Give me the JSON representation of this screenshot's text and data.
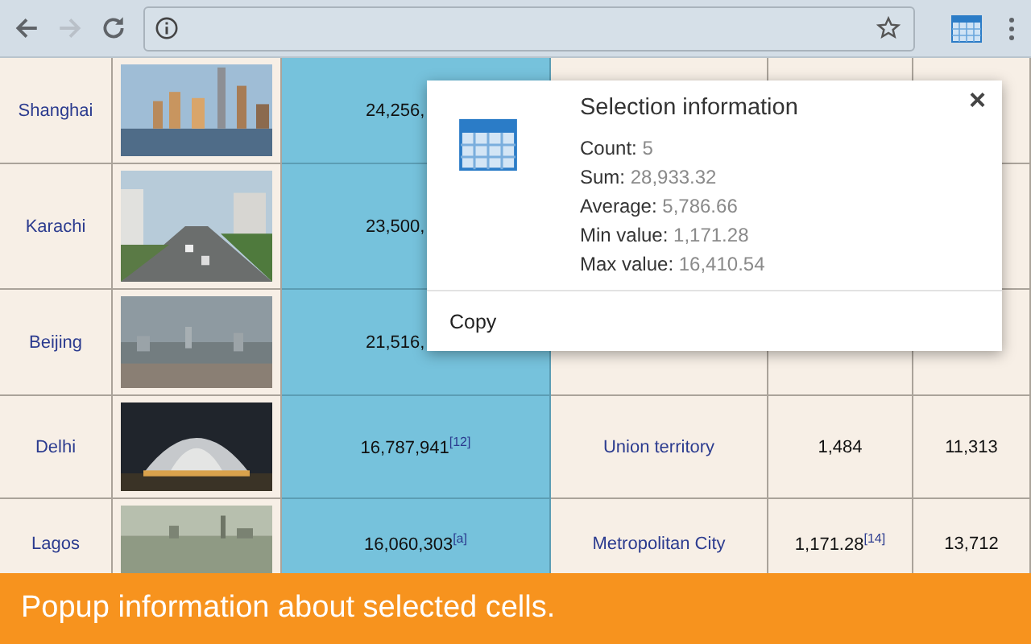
{
  "toolbar": {
    "forward_disabled": true
  },
  "table": {
    "rows": [
      {
        "city": "Shanghai",
        "population": "24,256,"
      },
      {
        "city": "Karachi",
        "population": "23,500,"
      },
      {
        "city": "Beijing",
        "population": "21,516,"
      },
      {
        "city": "Delhi",
        "population": "16,787,941$^{[12]}$",
        "column_4": "Union territory",
        "column_5": "1,484",
        "column_6": "11,313"
      },
      {
        "city": "Lagos",
        "population": "16,060,303$^{[a]}$",
        "column_4": "Metropolitan City",
        "column_5": "1,171.28$^{[14]}$",
        "column_6": "13,712"
      }
    ],
    "population_selected": true
  },
  "popup": {
    "title": "Selection information",
    "close": "×",
    "stats": [
      {
        "label": "Count:",
        "value": "5"
      },
      {
        "label": "Sum:",
        "value": "28,933.32"
      },
      {
        "label": "Average:",
        "value": "5,786.66"
      },
      {
        "label": "Min value:",
        "value": "1,171.28"
      },
      {
        "label": "Max value:",
        "value": "16,410.54"
      }
    ],
    "action": "Copy"
  },
  "banner": "Popup information about selected cells."
}
